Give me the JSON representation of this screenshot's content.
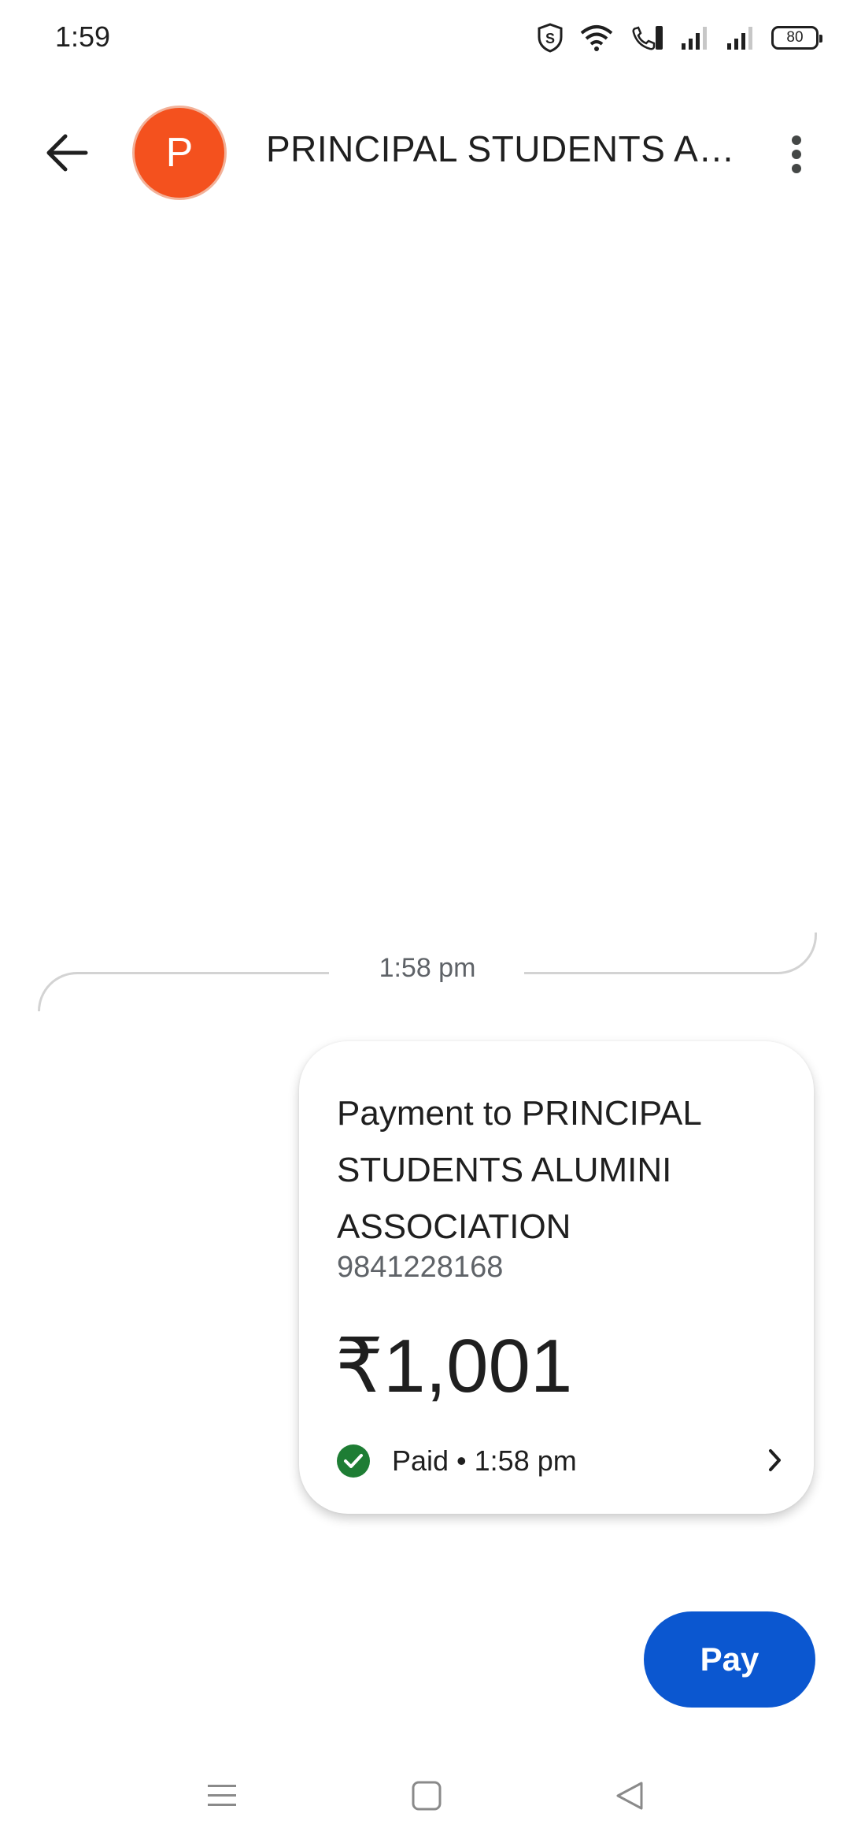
{
  "status_bar": {
    "time": "1:59",
    "battery": "80",
    "icons": [
      "shield-s-icon",
      "wifi-icon",
      "wifi-calling-icon",
      "signal-icon",
      "signal-icon",
      "battery-icon"
    ]
  },
  "header": {
    "avatar_letter": "P",
    "title": "PRINCIPAL STUDENTS ALUMINI ASSOCIATION",
    "colors": {
      "avatar": "#f4511e"
    }
  },
  "conversation": {
    "timestamp": "1:58 pm",
    "payment": {
      "title": "Payment to PRINCIPAL STUDENTS ALUMINI ASSOCIATION",
      "phone": "9841228168",
      "amount": "₹1,001",
      "status": "Paid • 1:58 pm",
      "status_color": "#1e7d34"
    }
  },
  "actions": {
    "pay_label": "Pay",
    "pay_color": "#0b57d0"
  },
  "nav": {
    "items": [
      "menu-icon",
      "home-square-icon",
      "back-triangle-icon"
    ]
  }
}
